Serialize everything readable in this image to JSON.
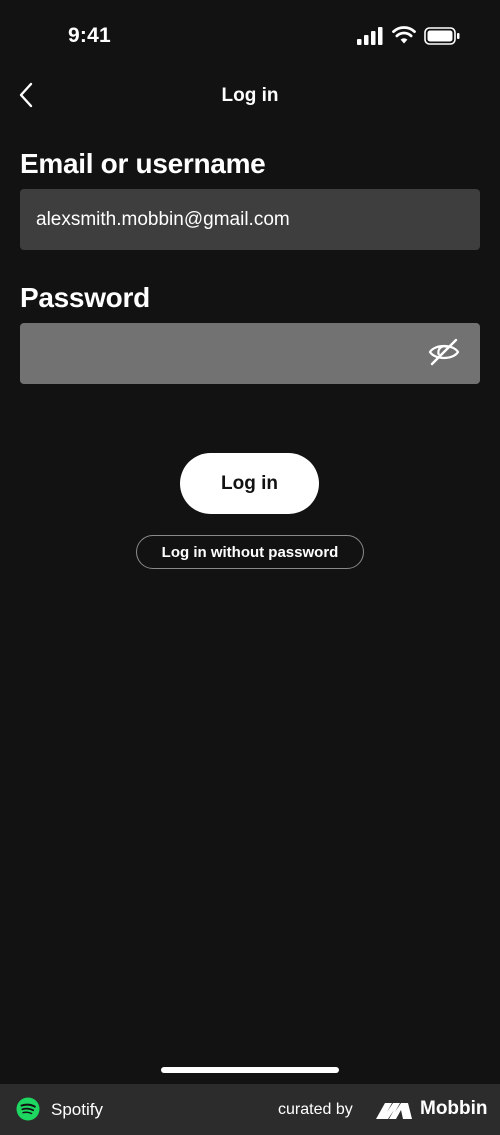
{
  "status_bar": {
    "time": "9:41",
    "icons": [
      "signal-icon",
      "wifi-icon",
      "battery-icon"
    ]
  },
  "nav": {
    "title": "Log in",
    "back_icon": "chevron-left-icon"
  },
  "form": {
    "email_label": "Email or username",
    "email_value": "alexsmith.mobbin@gmail.com",
    "password_label": "Password",
    "password_value": "",
    "password_toggle_icon": "eye-off-icon",
    "login_button": "Log in",
    "passwordless_button": "Log in without password"
  },
  "footer": {
    "app_name": "Spotify",
    "curated_by": "curated by",
    "brand": "Mobbin"
  },
  "colors": {
    "background": "#121212",
    "email_field": "#3e3e3e",
    "password_field": "#727272",
    "primary_button": "#ffffff",
    "footer_bg": "#2c2c2c",
    "spotify_green": "#1ed760"
  }
}
